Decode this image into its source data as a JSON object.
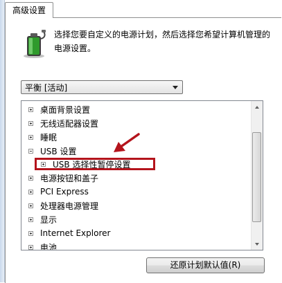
{
  "tab": {
    "label": "高级设置"
  },
  "description": "选择您要自定义的电源计划，然后选择您希望计算机管理的电源设置。",
  "plan_select": {
    "value": "平衡 [活动]"
  },
  "tree": {
    "items": [
      {
        "label": "桌面背景设置",
        "state": "collapsed"
      },
      {
        "label": "无线适配器设置",
        "state": "collapsed"
      },
      {
        "label": "睡眠",
        "state": "collapsed"
      },
      {
        "label": "USB 设置",
        "state": "expanded"
      },
      {
        "label": "USB 选择性暂停设置",
        "state": "collapsed",
        "highlighted": true
      },
      {
        "label": "电源按钮和盖子",
        "state": "collapsed"
      },
      {
        "label": "PCI Express",
        "state": "collapsed"
      },
      {
        "label": "处理器电源管理",
        "state": "collapsed"
      },
      {
        "label": "显示",
        "state": "collapsed"
      },
      {
        "label": "Internet Explorer",
        "state": "collapsed"
      },
      {
        "label": "电池",
        "state": "collapsed"
      }
    ]
  },
  "buttons": {
    "restore": "还原计划默认值(R)"
  },
  "colors": {
    "highlight": "#b4141c",
    "arrow": "#b4141c"
  }
}
